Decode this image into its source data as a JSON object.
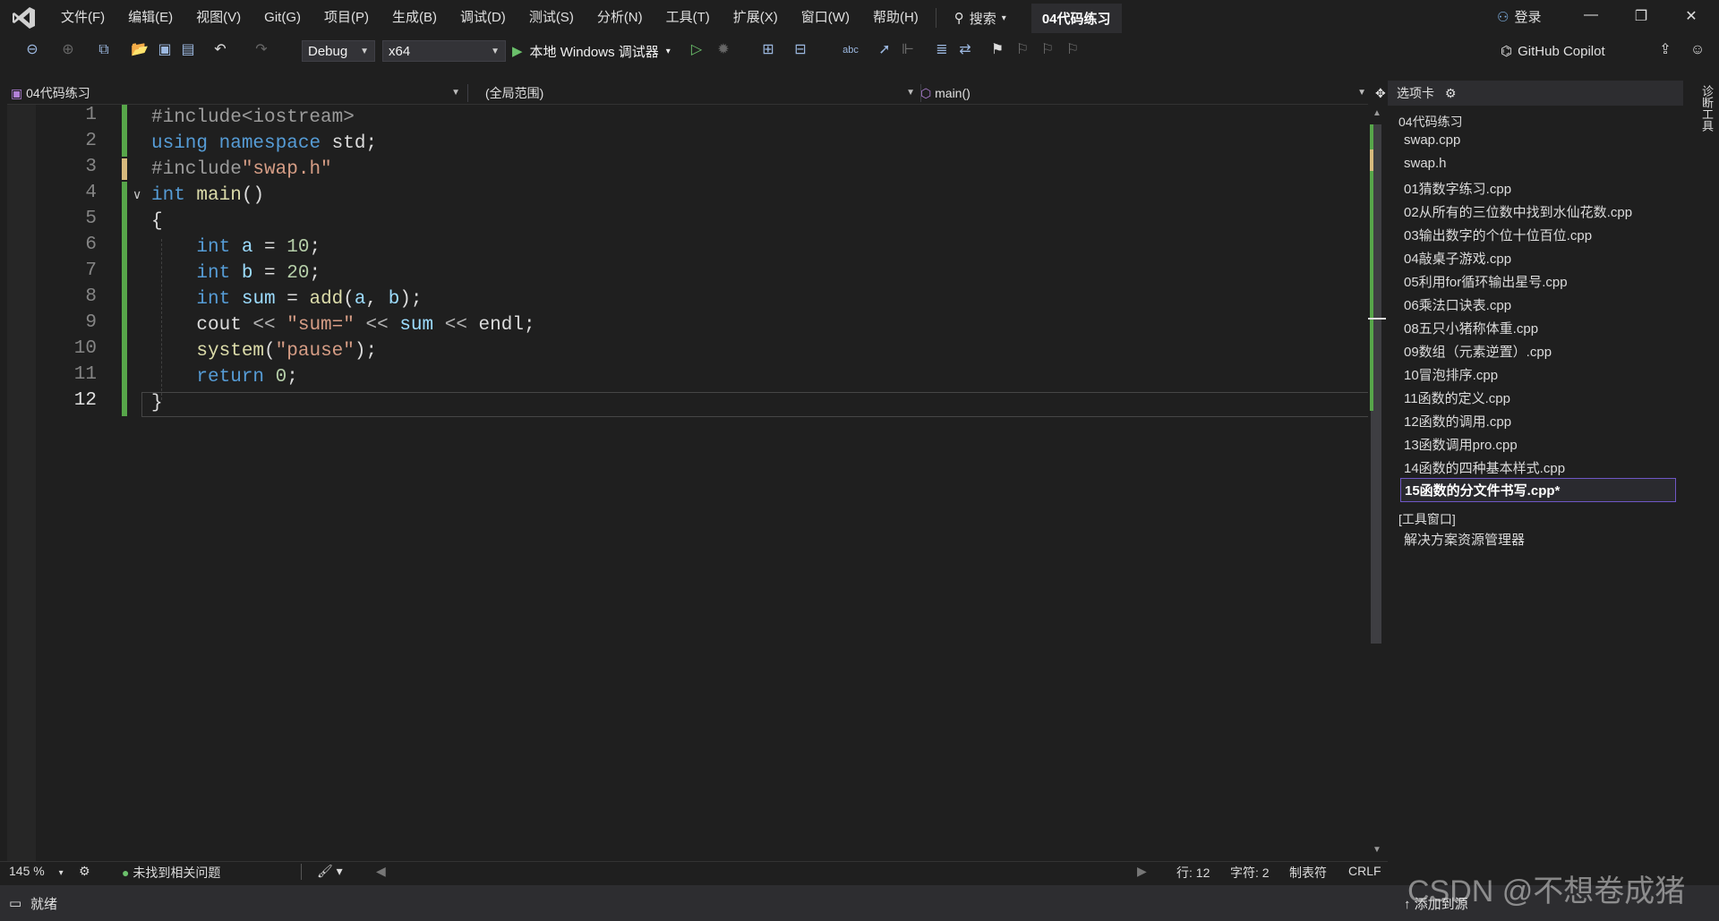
{
  "menubar": {
    "items": [
      "文件(F)",
      "编辑(E)",
      "视图(V)",
      "Git(G)",
      "项目(P)",
      "生成(B)",
      "调试(D)",
      "测试(S)",
      "分析(N)",
      "工具(T)",
      "扩展(X)",
      "窗口(W)",
      "帮助(H)"
    ],
    "search_label": "搜索",
    "solution_title": "04代码练习",
    "login_label": "登录"
  },
  "toolbar": {
    "config": "Debug",
    "platform": "x64",
    "run_label": "本地 Windows 调试器",
    "copilot_label": "GitHub Copilot"
  },
  "navbar": {
    "project": "04代码练习",
    "scope": "(全局范围)",
    "member": "main()"
  },
  "editor": {
    "line_numbers": [
      "1",
      "2",
      "3",
      "4",
      "5",
      "6",
      "7",
      "8",
      "9",
      "10",
      "11",
      "12"
    ],
    "current_line": 12,
    "lines": [
      [
        {
          "c": "pp",
          "t": "#include<"
        },
        {
          "c": "pp",
          "t": "iostream"
        },
        {
          "c": "pp",
          "t": ">"
        }
      ],
      [
        {
          "c": "kw",
          "t": "using"
        },
        {
          "c": "",
          "t": " "
        },
        {
          "c": "kw",
          "t": "namespace"
        },
        {
          "c": "",
          "t": " std;"
        }
      ],
      [
        {
          "c": "pp",
          "t": "#include"
        },
        {
          "c": "str",
          "t": "\"swap.h\""
        }
      ],
      [
        {
          "c": "kw",
          "t": "int"
        },
        {
          "c": "",
          "t": " "
        },
        {
          "c": "fn",
          "t": "main"
        },
        {
          "c": "",
          "t": "()"
        }
      ],
      [
        {
          "c": "",
          "t": "{"
        }
      ],
      [
        {
          "c": "",
          "t": "    "
        },
        {
          "c": "kw",
          "t": "int"
        },
        {
          "c": "",
          "t": " "
        },
        {
          "c": "var",
          "t": "a"
        },
        {
          "c": "",
          "t": " = "
        },
        {
          "c": "num",
          "t": "10"
        },
        {
          "c": "",
          "t": ";"
        }
      ],
      [
        {
          "c": "",
          "t": "    "
        },
        {
          "c": "kw",
          "t": "int"
        },
        {
          "c": "",
          "t": " "
        },
        {
          "c": "var",
          "t": "b"
        },
        {
          "c": "",
          "t": " = "
        },
        {
          "c": "num",
          "t": "20"
        },
        {
          "c": "",
          "t": ";"
        }
      ],
      [
        {
          "c": "",
          "t": "    "
        },
        {
          "c": "kw",
          "t": "int"
        },
        {
          "c": "",
          "t": " "
        },
        {
          "c": "var",
          "t": "sum"
        },
        {
          "c": "",
          "t": " = "
        },
        {
          "c": "fn",
          "t": "add"
        },
        {
          "c": "",
          "t": "("
        },
        {
          "c": "var",
          "t": "a"
        },
        {
          "c": "",
          "t": ", "
        },
        {
          "c": "var",
          "t": "b"
        },
        {
          "c": "",
          "t": ");"
        }
      ],
      [
        {
          "c": "",
          "t": "    cout "
        },
        {
          "c": "op",
          "t": "<<"
        },
        {
          "c": "",
          "t": " "
        },
        {
          "c": "str",
          "t": "\"sum=\""
        },
        {
          "c": "",
          "t": " "
        },
        {
          "c": "op",
          "t": "<<"
        },
        {
          "c": "",
          "t": " "
        },
        {
          "c": "var",
          "t": "sum"
        },
        {
          "c": "",
          "t": " "
        },
        {
          "c": "op",
          "t": "<<"
        },
        {
          "c": "",
          "t": " endl;"
        }
      ],
      [
        {
          "c": "",
          "t": "    "
        },
        {
          "c": "fn",
          "t": "system"
        },
        {
          "c": "",
          "t": "("
        },
        {
          "c": "str",
          "t": "\"pause\""
        },
        {
          "c": "",
          "t": ");"
        }
      ],
      [
        {
          "c": "",
          "t": "    "
        },
        {
          "c": "kw",
          "t": "return"
        },
        {
          "c": "",
          "t": " "
        },
        {
          "c": "num",
          "t": "0"
        },
        {
          "c": "",
          "t": ";"
        }
      ],
      [
        {
          "c": "",
          "t": "}"
        }
      ]
    ]
  },
  "rightpanel": {
    "header": "选项卡",
    "group": "04代码练习",
    "files": [
      "swap.cpp",
      "swap.h",
      "01猜数字练习.cpp",
      "02从所有的三位数中找到水仙花数.cpp",
      "03输出数字的个位十位百位.cpp",
      "04敲桌子游戏.cpp",
      "05利用for循环输出星号.cpp",
      "06乘法口诀表.cpp",
      "08五只小猪称体重.cpp",
      "09数组（元素逆置）.cpp",
      "10冒泡排序.cpp",
      "11函数的定义.cpp",
      "12函数的调用.cpp",
      "13函数调用pro.cpp",
      "14函数的四种基本样式.cpp"
    ],
    "active_file": "15函数的分文件书写.cpp*",
    "tools_group": "[工具窗口]",
    "explorer": "解决方案资源管理器",
    "side_tab": "诊断工具"
  },
  "edstatus": {
    "zoom": "145 %",
    "issues": "未找到相关问题",
    "line": "行: 12",
    "col": "字符: 2",
    "tabs": "制表符",
    "eol": "CRLF"
  },
  "statusbar": {
    "ready": "就绪",
    "add_source": "添加到源",
    "watermark": "CSDN @不想卷成猪"
  },
  "colors": {
    "accent": "#57a64a",
    "active_border": "#6f57c5"
  }
}
